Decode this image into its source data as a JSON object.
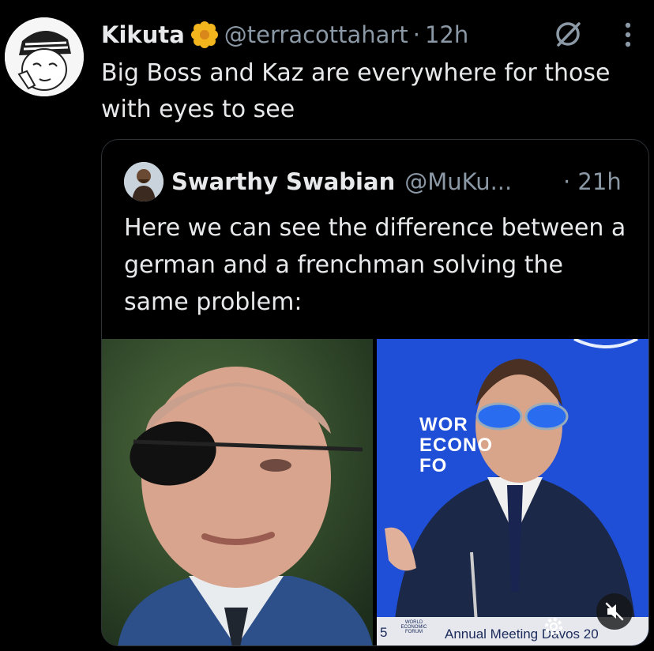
{
  "tweet": {
    "author_name": "Kikuta",
    "badge_icon": "flower-emoji",
    "handle": "@terracottahart",
    "separator": "·",
    "time": "12h",
    "text": "Big Boss and Kaz are everywhere for those with eyes to see"
  },
  "quoted": {
    "author_name": "Swarthy Swabian",
    "handle": "@MuKu...",
    "time": "· 21h",
    "text": "Here we can see the difference between a german and a frenchman solving the same problem:"
  },
  "media": {
    "left_image": "man-with-eyepatch-photo",
    "right_image": "man-with-blue-sunglasses-at-forum-photo",
    "backdrop_text": "WOR\nECONO\nFO",
    "banner_logo_text": "WORLD\nECONOMIC\nFORUM",
    "banner_text": "Annual Meeting Davos 20",
    "banner_number": "5"
  },
  "colors": {
    "background": "#000000",
    "text_primary": "#e7e9ea",
    "text_secondary": "#8b98a5",
    "border": "#2f3336",
    "forum_blue": "#1f4fd6"
  },
  "icons": [
    "grok-icon",
    "more-options-icon",
    "mute-icon",
    "settings-gear-icon"
  ]
}
